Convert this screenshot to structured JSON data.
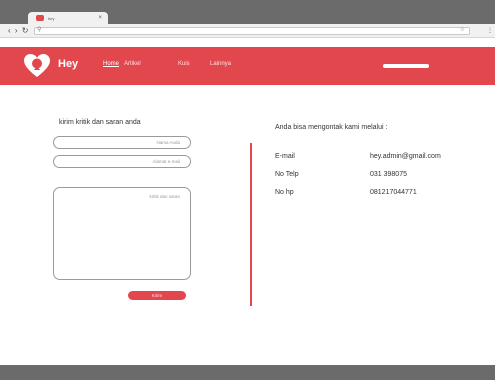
{
  "browser": {
    "tab_title": "hey",
    "tab_close": "×",
    "nav_glyphs": "‹ › ↻",
    "search_glyph": "⚲",
    "star_glyph": "☆",
    "menu_glyph": "⋮"
  },
  "header": {
    "brand": "Hey",
    "nav": [
      "Home",
      "Artikel",
      "Kuis",
      "Lainnya"
    ],
    "active_nav": "Home",
    "accent_color": "#e2474d"
  },
  "form": {
    "title": "kirim kritik dan saran anda",
    "name_placeholder": "Nama Anda",
    "email_placeholder": "Alamat e-mail",
    "message_placeholder": "kritik dan saran",
    "submit_label": "Kirim"
  },
  "contact": {
    "title": "Anda bisa mengontak kami melalui :",
    "rows": [
      {
        "label": "E-mail",
        "value": "hey.admin@gmail.com"
      },
      {
        "label": "No Telp",
        "value": "031 398075"
      },
      {
        "label": "No hp",
        "value": "081217044771"
      }
    ]
  }
}
